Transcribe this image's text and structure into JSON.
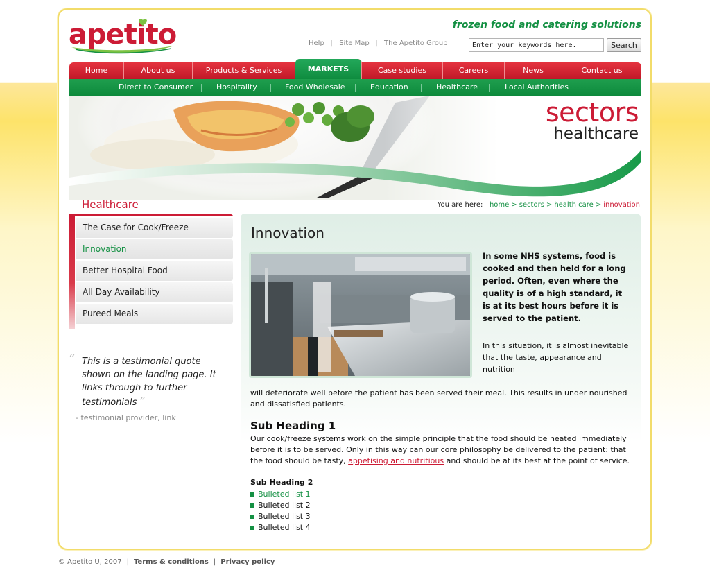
{
  "brand": {
    "logo_text": "apetito",
    "tagline": "frozen food and catering solutions",
    "colors": {
      "red": "#cc1b35",
      "green": "#149043",
      "yellow": "#fde36a"
    }
  },
  "header": {
    "util_links": [
      "Help",
      "Site Map",
      "The Apetito Group"
    ],
    "search": {
      "placeholder": "Enter your keywords here.",
      "value": "Enter your keywords here.",
      "button_label": "Search"
    }
  },
  "main_nav": [
    {
      "label": "Home",
      "active": false
    },
    {
      "label": "About us",
      "active": false
    },
    {
      "label": "Products & Services",
      "active": false
    },
    {
      "label": "MARKETS",
      "active": true
    },
    {
      "label": "Case studies",
      "active": false
    },
    {
      "label": "Careers",
      "active": false
    },
    {
      "label": "News",
      "active": false
    },
    {
      "label": "Contact us",
      "active": false
    }
  ],
  "sub_nav": [
    {
      "label": "Direct to Consumer"
    },
    {
      "label": "Hospitality"
    },
    {
      "label": "Food Wholesale"
    },
    {
      "label": "Education"
    },
    {
      "label": "Healthcare"
    },
    {
      "label": "Local Authorities"
    }
  ],
  "banner": {
    "title": "sectors",
    "subtitle": "healthcare"
  },
  "section_title": "Healthcare",
  "breadcrumb": {
    "prefix": "You are here:",
    "items": [
      "home",
      "sectors",
      "health care",
      "innovation"
    ]
  },
  "sidebar": {
    "items": [
      {
        "label": "The Case for Cook/Freeze",
        "active": false
      },
      {
        "label": "Innovation",
        "active": true
      },
      {
        "label": "Better Hospital Food",
        "active": false
      },
      {
        "label": "All Day Availability",
        "active": false
      },
      {
        "label": "Pureed Meals",
        "active": false
      }
    ]
  },
  "testimonial": {
    "open_mark": "“",
    "quote": "This is a testimonial quote shown on the landing page. It links through to further testimonials",
    "close_mark": "”",
    "provider": "- testimonial provider, link"
  },
  "content": {
    "title": "Innovation",
    "intro_bold": "In some NHS systems, food is cooked and then held for a long period. Often, even where the quality is of a high standard, it is at its best hours before it is served to the patient.",
    "intro_normal": "In this situation, it is almost inevitable that the taste, appearance and nutrition",
    "intro_continued": "will deteriorate well before the patient has been served their meal.   This results in under nourished and dissatisfied patients.",
    "sub_heading_1": "Sub Heading 1",
    "para_1_before": "Our cook/freeze systems work on the simple principle that the food should be heated immediately before it is to be served. Only in this way can our core philosophy be delivered to the patient: that the food should be tasty, ",
    "para_1_link": "appetising and nutritious",
    "para_1_after": " and should be at its best at the point of service.",
    "sub_heading_2": "Sub Heading 2",
    "bullets": [
      "Bulleted list 1",
      "Bulleted list 2",
      "Bulleted list 3",
      "Bulleted list 4"
    ]
  },
  "footer": {
    "copyright": "© Apetito U, 2007",
    "links": [
      "Terms & conditions",
      "Privacy policy"
    ]
  }
}
